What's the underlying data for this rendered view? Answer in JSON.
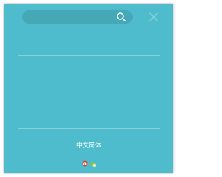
{
  "search": {
    "value": "",
    "placeholder": "",
    "icon": "search-icon"
  },
  "close": {
    "icon": "close-icon"
  },
  "menu": {
    "items": [
      "",
      "",
      "",
      ""
    ]
  },
  "footer": {
    "language_label": "中文简体",
    "social": [
      {
        "icon": "weibo-icon",
        "color": "#e0462f"
      },
      {
        "icon": "wechat-icon",
        "color": "#8bc34a"
      }
    ]
  },
  "colors": {
    "panel_background": "#4ebccd",
    "search_background": "#44a8b7",
    "divider": "#84d1dc",
    "text": "#ffffff"
  }
}
